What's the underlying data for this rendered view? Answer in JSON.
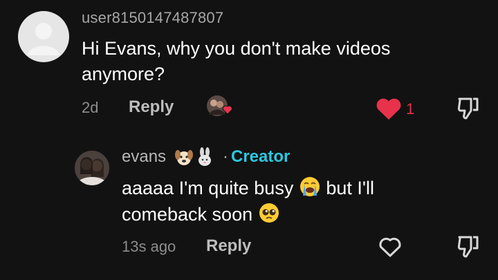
{
  "comment": {
    "username": "user8150147487807",
    "text": "Hi Evans, why you don't make videos anymore?",
    "timestamp": "2d",
    "reply_label": "Reply",
    "like_count": "1"
  },
  "reply": {
    "username": "evans",
    "username_emojis": [
      "dog-face-emoji",
      "rabbit-emoji"
    ],
    "badge_separator": "·",
    "badge": "Creator",
    "text_part1": "aaaaa I'm quite busy",
    "text_part2": "but I'll comeback soon",
    "text_emojis": [
      "crying-face-emoji",
      "pleading-face-emoji"
    ],
    "timestamp": "13s ago",
    "reply_label": "Reply"
  },
  "colors": {
    "background": "#121212",
    "like_red": "#e8324b",
    "creator_cyan": "#2bc8e0"
  },
  "icons": [
    "liked-avatar-heart-icon",
    "heart-icon",
    "dislike-icon",
    "heart-outline-icon"
  ]
}
